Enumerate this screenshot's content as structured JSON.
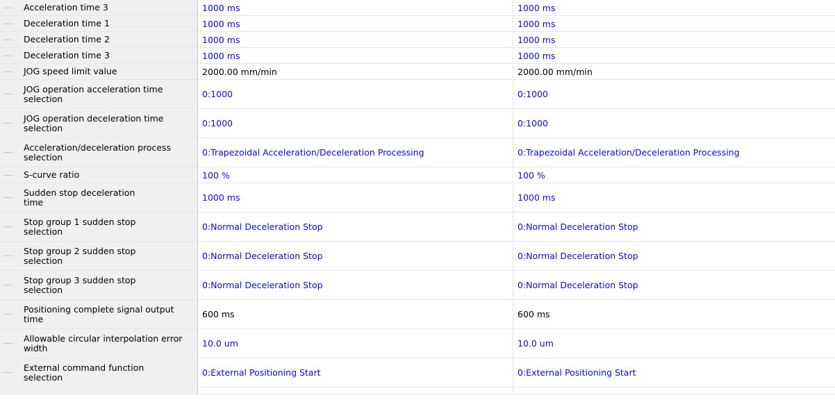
{
  "rows": [
    {
      "label": "Acceleration time 3",
      "v1": "1000 ms",
      "v2": "1000 ms",
      "c": "blue"
    },
    {
      "label": "Deceleration time 1",
      "v1": "1000 ms",
      "v2": "1000 ms",
      "c": "blue"
    },
    {
      "label": "Deceleration time 2",
      "v1": "1000 ms",
      "v2": "1000 ms",
      "c": "blue"
    },
    {
      "label": "Deceleration time 3",
      "v1": "1000 ms",
      "v2": "1000 ms",
      "c": "blue"
    },
    {
      "label": "JOG speed limit value",
      "v1": "2000.00 mm/min",
      "v2": "2000.00 mm/min",
      "c": "black"
    },
    {
      "label": "JOG operation acceleration time selection",
      "v1": "0:1000",
      "v2": "0:1000",
      "c": "blue"
    },
    {
      "label": "JOG operation deceleration time selection",
      "v1": "0:1000",
      "v2": "0:1000",
      "c": "blue"
    },
    {
      "label": "Acceleration/deceleration process selection",
      "v1": "0:Trapezoidal Acceleration/Deceleration Processing",
      "v2": "0:Trapezoidal Acceleration/Deceleration Processing",
      "c": "blue"
    },
    {
      "label": "S-curve ratio",
      "v1": "100 %",
      "v2": "100 %",
      "c": "blue"
    },
    {
      "label": "Sudden stop deceleration time",
      "v1": "1000 ms",
      "v2": "1000 ms",
      "c": "blue"
    },
    {
      "label": "Stop group 1 sudden stop selection",
      "v1": "0:Normal Deceleration Stop",
      "v2": "0:Normal Deceleration Stop",
      "c": "blue"
    },
    {
      "label": "Stop group 2 sudden stop selection",
      "v1": "0:Normal Deceleration Stop",
      "v2": "0:Normal Deceleration Stop",
      "c": "blue"
    },
    {
      "label": "Stop group 3 sudden stop selection",
      "v1": "0:Normal Deceleration Stop",
      "v2": "0:Normal Deceleration Stop",
      "c": "blue"
    },
    {
      "label": "Positioning complete signal output time",
      "v1": "600 ms",
      "v2": "600 ms",
      "c": "black"
    },
    {
      "label": "Allowable circular interpolation error width",
      "v1": "10.0 um",
      "v2": "10.0 um",
      "c": "blue"
    },
    {
      "label": "External command function selection",
      "v1": "0:External Positioning Start",
      "v2": "0:External Positioning Start",
      "c": "blue"
    }
  ],
  "colors": {
    "value_blue": "#0a0ad0",
    "value_black": "#000000"
  }
}
